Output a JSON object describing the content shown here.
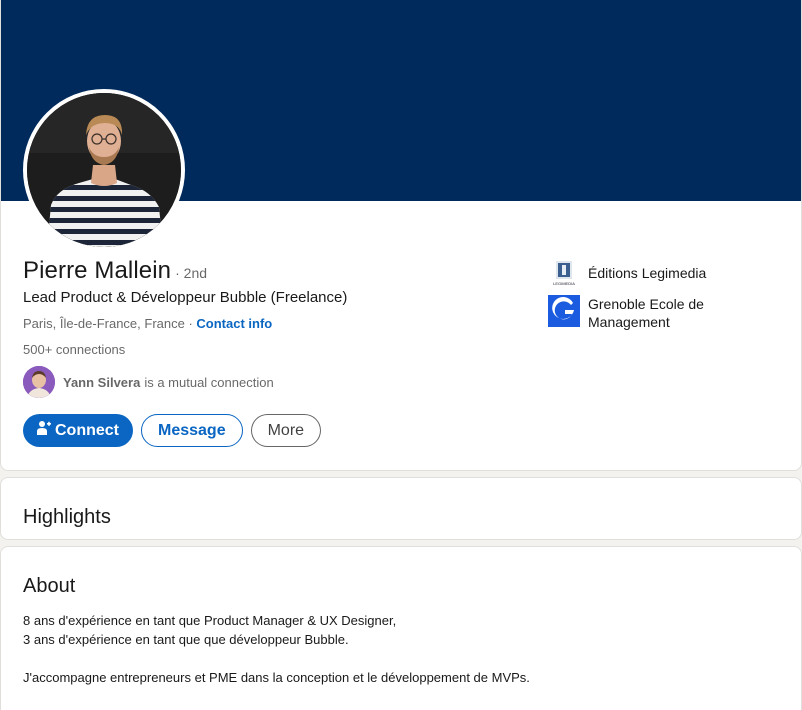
{
  "profile": {
    "name": "Pierre Mallein",
    "degree": "· 2nd",
    "headline": "Lead Product & Développeur Bubble (Freelance)",
    "location": "Paris, Île-de-France, France ·",
    "contact_info": "Contact info",
    "connections": "500+ connections",
    "mutual_name": "Yann Silvera",
    "mutual_text": "is a mutual connection"
  },
  "actions": {
    "connect": "Connect",
    "message": "Message",
    "more": "More"
  },
  "companies": [
    {
      "name": "Éditions Legimedia",
      "logo_text": "LEGIMEDIA",
      "icon": "legimedia-logo"
    },
    {
      "name": "Grenoble Ecole de Management",
      "icon": "grenoble-logo"
    }
  ],
  "highlights": {
    "title": "Highlights"
  },
  "about": {
    "title": "About",
    "line1": "8 ans d'expérience en tant que Product Manager & UX Designer,",
    "line2": "3 ans d'expérience en tant que que développeur Bubble.",
    "line3": "J'accompagne entrepreneurs et PME dans la conception et le développement de MVPs."
  },
  "colors": {
    "banner": "#002a5c",
    "accent": "#0a66c2",
    "grenoble": "#1a5be0"
  }
}
